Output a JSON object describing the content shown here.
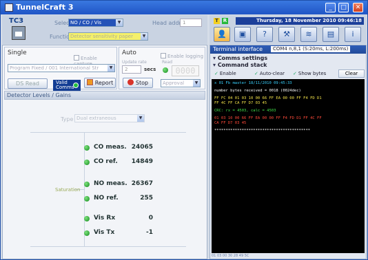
{
  "window": {
    "title": "TunnelCraft 3",
    "minimize_glyph": "_",
    "maximize_glyph": "□",
    "close_glyph": "✕"
  },
  "toolbar_left": {
    "logo_text": "TC3",
    "select_label": "Select",
    "select_value": "NO / CO / Vis",
    "head_label": "Head address",
    "head_value": "1",
    "function_label": "Function",
    "function_value": "Detector sensitivity paper"
  },
  "toolbar_right": {
    "tag_t": "T",
    "tag_r": "R",
    "date": "Thursday, 18 November 2010  09:46:18",
    "buttons": [
      {
        "icon": "person-icon",
        "glyph": "👤"
      },
      {
        "icon": "monitor-icon",
        "glyph": "▣"
      },
      {
        "icon": "help-icon",
        "glyph": "?"
      },
      {
        "icon": "tools-icon",
        "glyph": "⚒"
      },
      {
        "icon": "layers-icon",
        "glyph": "≋"
      },
      {
        "icon": "panel-icon",
        "glyph": "▤"
      },
      {
        "icon": "info-icon",
        "glyph": "i"
      }
    ]
  },
  "single": {
    "title": "Single",
    "enable_capture": "Enable capture",
    "program_value": "Program Fixed / 001 International Str",
    "read_button": "DS Read",
    "valid_line1": "Valid",
    "valid_line2": "Comms",
    "report_button": "Report",
    "stop_button": "Stop"
  },
  "auto": {
    "title": "Auto",
    "enable_logging": "Enable logging",
    "update_rate_label": "Update rate",
    "secs_value": "2",
    "secs_label": "secs",
    "read_label": "Read",
    "led_value": "0000",
    "approval_value": "Approval"
  },
  "detector": {
    "bar_title": "Detector Levels / Gains",
    "type_label": "Type",
    "type_value": "Dual extraneous",
    "saturation_label": "Saturation",
    "measurements": [
      {
        "label": "CO meas.",
        "value": "24065"
      },
      {
        "label": "CO ref.",
        "value": "14849"
      },
      {
        "label": "NO meas.",
        "value": "26367"
      },
      {
        "label": "NO ref.",
        "value": "255"
      },
      {
        "label": "Vis Rx",
        "value": "0"
      },
      {
        "label": "Vis Tx",
        "value": "-1"
      }
    ]
  },
  "terminal": {
    "header_title": "Terminal interface",
    "port_value": "COM4 n,8,1  (S:20ms, L:200ms)",
    "comms_settings": "Comms settings",
    "command_stack": "Command stack",
    "opt_enable": "Enable",
    "opt_autoclear": "Auto-clear",
    "opt_showbytes": "Show bytes",
    "clear_button": "Clear",
    "lines": {
      "l1": "x 01 Fb master  18/11/2010 09:45:33",
      "l2": "number bytes received = 0018 (0024dec)",
      "l3": "FF FC 04 01 03 10 00 66 FF EA 00 00 FF F4 FD D1",
      "l4": "FF 4C FF CA FF D7 03 45",
      "l5": "CRC: rx = 4503, calc = 4503",
      "l6": "01 03 10 00 66 FF EA 00 00 FF F4 FD D1 FF 4C FF",
      "l7": "CA FF D7 03 45",
      "l8": "******************************************"
    },
    "status_text": "01 03 00 30 28 49 5C"
  },
  "colors": {
    "titlebar": "#1f55c6",
    "accent": "#123c93",
    "ok_green": "#23c040",
    "console_bg": "#000000"
  }
}
